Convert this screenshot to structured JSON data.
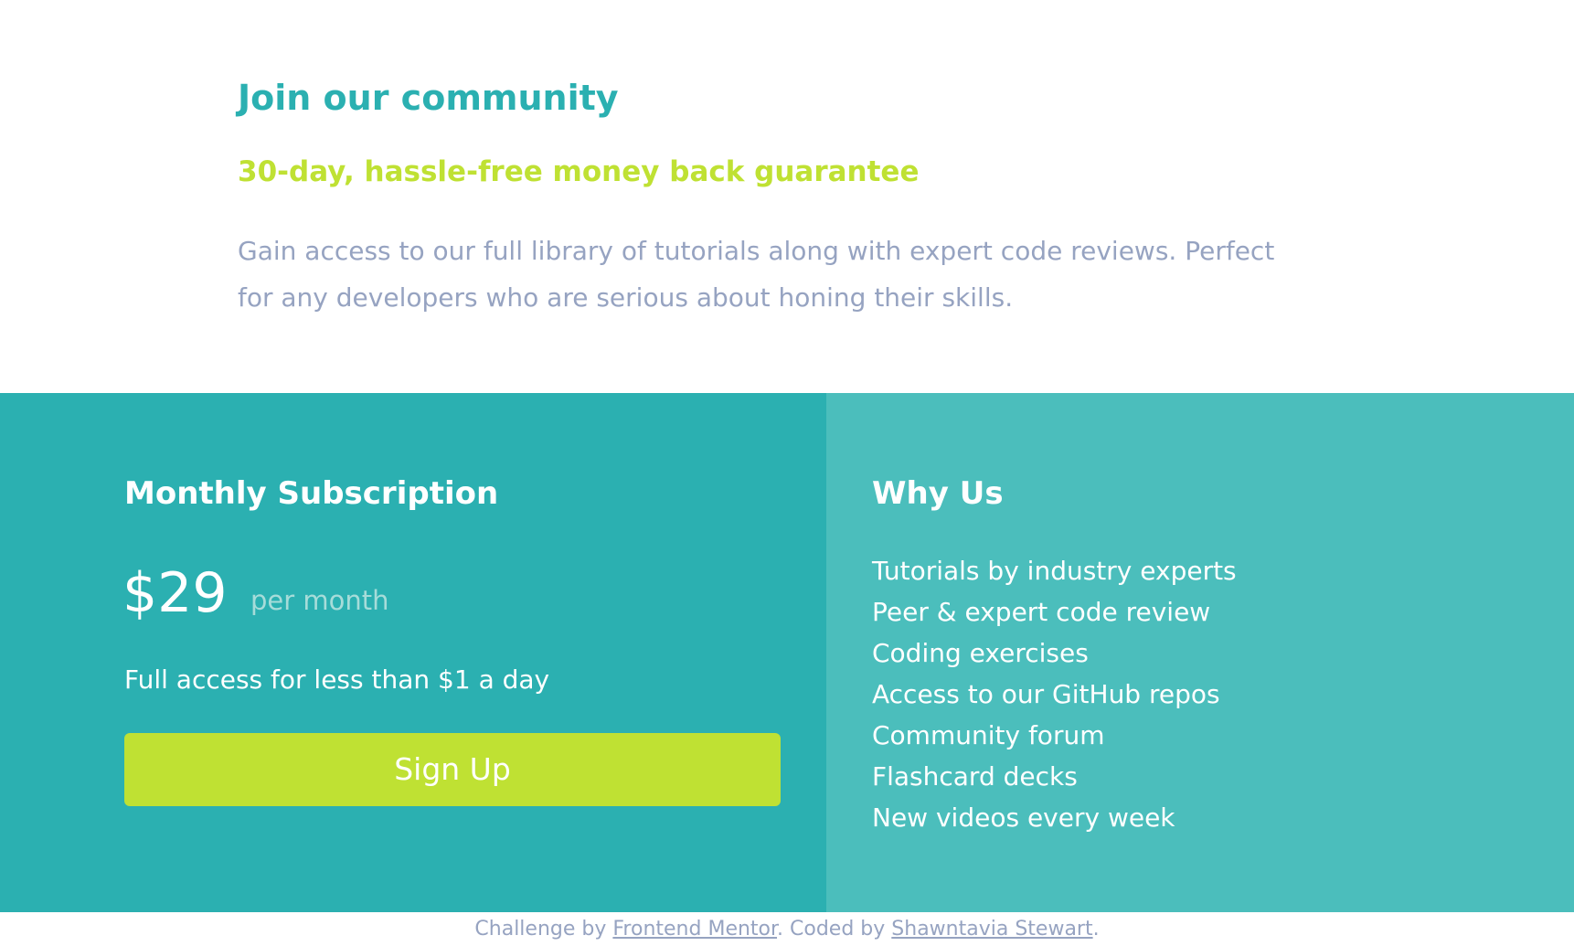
{
  "hero": {
    "title": "Join our community",
    "subtitle": "30-day, hassle-free money back guarantee",
    "description": "Gain access to our full library of tutorials along with expert code reviews. Perfect for any developers who are serious about honing their skills."
  },
  "subscription": {
    "title": "Monthly Subscription",
    "price": "$29",
    "period": "per month",
    "tagline": "Full access for less than $1 a day",
    "button_label": "Sign Up"
  },
  "why_us": {
    "title": "Why Us",
    "items": [
      "Tutorials by industry experts",
      "Peer & expert code review",
      "Coding exercises",
      "Access to our GitHub repos",
      "Community forum",
      "Flashcard decks",
      "New videos every week"
    ]
  },
  "footer": {
    "prefix": "Challenge by ",
    "link1": "Frontend Mentor",
    "middle": ". Coded by ",
    "link2": "Shawntavia Stewart",
    "suffix": "."
  },
  "colors": {
    "primary_teal": "#2bb0b1",
    "secondary_teal": "#4bbebc",
    "accent_lime": "#bfe133",
    "muted_text": "#96a3c1",
    "price_period": "#a6dcd9"
  }
}
